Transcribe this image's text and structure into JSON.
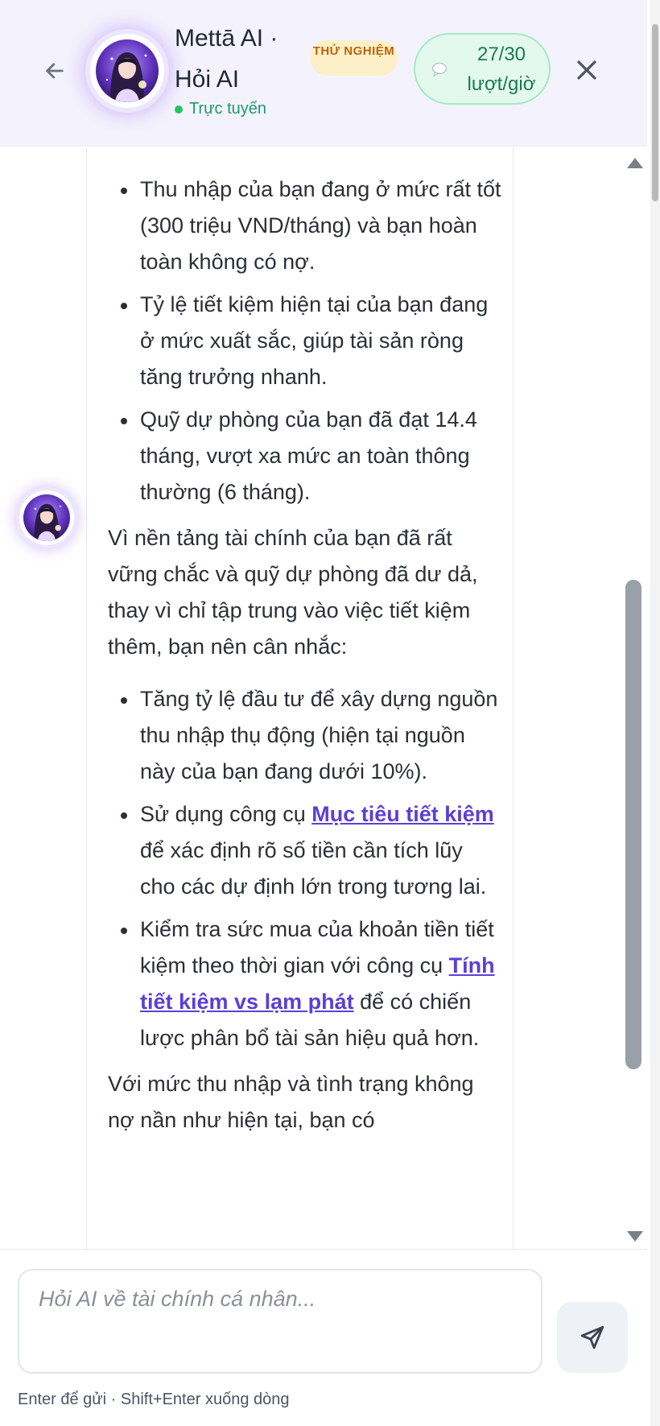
{
  "header": {
    "title": "Mettā AI · Hỏi AI",
    "status": "Trực tuyến",
    "beta_badge": "THỬ NGHIỆM",
    "quota": "27/30 lượt/giờ"
  },
  "icons": {
    "back": "arrow-left-icon",
    "close": "close-icon",
    "send": "send-icon",
    "quota": "chat-bubble-icon",
    "scroll_up": "triangle-up-icon",
    "scroll_down": "triangle-down-icon"
  },
  "colors": {
    "accent": "#5b3fd6",
    "online": "#22c55e",
    "beta_bg": "#fdf0c8",
    "quota_bg": "#e3f9ee"
  },
  "message": {
    "bullets_1": [
      "Thu nhập của bạn đang ở mức rất tốt (300 triệu VND/tháng) và bạn hoàn toàn không có nợ.",
      "Tỷ lệ tiết kiệm hiện tại của bạn đang ở mức xuất sắc, giúp tài sản ròng tăng trưởng nhanh.",
      "Quỹ dự phòng của bạn đã đạt 14.4 tháng, vượt xa mức an toàn thông thường (6 tháng)."
    ],
    "paragraph_1": "Vì nền tảng tài chính của bạn đã rất vững chắc và quỹ dự phòng đã dư dả, thay vì chỉ tập trung vào việc tiết kiệm thêm, bạn nên cân nhắc:",
    "bullet_2a": "Tăng tỷ lệ đầu tư để xây dựng nguồn thu nhập thụ động (hiện tại nguồn này của bạn đang dưới 10%).",
    "bullet_2b": {
      "before": "Sử dụng công cụ ",
      "link": "Mục tiêu tiết kiệm",
      "after": " để xác định rõ số tiền cần tích lũy cho các dự định lớn trong tương lai."
    },
    "bullet_2c": {
      "before": "Kiểm tra sức mua của khoản tiền tiết kiệm theo thời gian với công cụ ",
      "link": "Tính tiết kiệm vs lạm phát",
      "after": " để có chiến lược phân bổ tài sản hiệu quả hơn."
    },
    "paragraph_2": "Với mức thu nhập và tình trạng không nợ nần như hiện tại, bạn có"
  },
  "composer": {
    "placeholder": "Hỏi AI về tài chính cá nhân...",
    "hint": "Enter để gửi · Shift+Enter xuống dòng"
  }
}
